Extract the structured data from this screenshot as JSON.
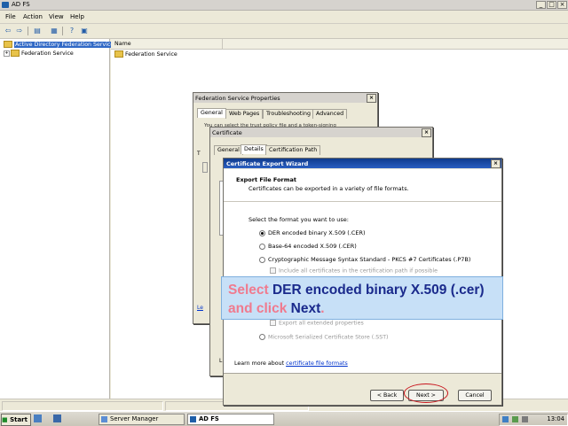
{
  "window": {
    "title": "AD FS"
  },
  "menu": [
    "File",
    "Action",
    "View",
    "Help"
  ],
  "tree": {
    "root": "Active Directory Federation Services",
    "child": "Federation Service"
  },
  "list": {
    "column": "Name",
    "item": "Federation Service"
  },
  "props_dialog": {
    "title": "Federation Service Properties",
    "tabs": [
      "General",
      "Web Pages",
      "Troubleshooting",
      "Advanced"
    ],
    "partial_text": "You can select the trust policy file and a token-signing",
    "partial_link": "Le"
  },
  "cert_dialog": {
    "title": "Certificate",
    "tabs": [
      "General",
      "Details",
      "Certification Path"
    ]
  },
  "wizard": {
    "title": "Certificate Export Wizard",
    "heading": "Export File Format",
    "subheading": "Certificates can be exported in a variety of file formats.",
    "prompt": "Select the format you want to use:",
    "options": [
      "DER encoded binary X.509 (.CER)",
      "Base-64 encoded X.509 (.CER)",
      "Cryptographic Message Syntax Standard - PKCS #7 Certificates (.P7B)"
    ],
    "include_all": "Include all certificates in the certification path if possible",
    "export_ext": "Export all extended properties",
    "ms_store": "Microsoft Serialized Certificate Store (.SST)",
    "learn_prefix": "Learn more about",
    "learn_link": "certificate file formats",
    "buttons": {
      "back": "< Back",
      "next": "Next >",
      "cancel": "Cancel"
    }
  },
  "callout": {
    "part1": "Select ",
    "part2": "DER encoded binary X.509 (.cer) ",
    "part3": "and click ",
    "part4": "Next",
    "part5": "."
  },
  "taskbar": {
    "start": "Start",
    "tasks": [
      "Server Manager",
      "AD FS"
    ],
    "clock": "13:04"
  },
  "colors": {
    "highlight": "#c8141c",
    "callout_bg": "#c7e0f7",
    "callout_text": "#1a2a8c",
    "callout_accent": "#f07a8e"
  }
}
